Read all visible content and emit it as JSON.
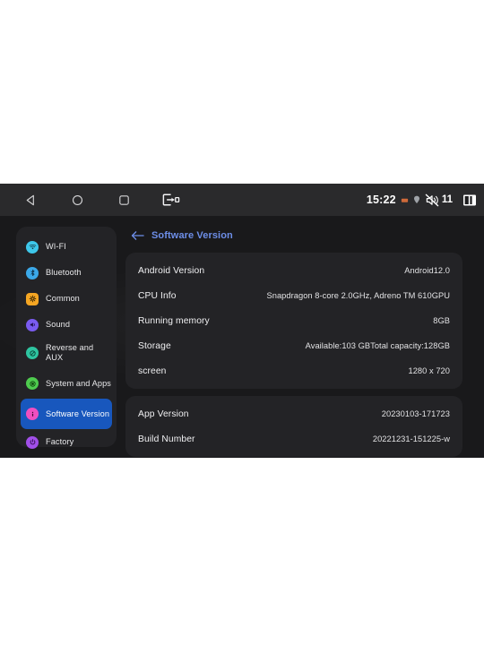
{
  "navbar": {
    "buttons": [
      {
        "name": "back",
        "icon": "triangle-left-icon",
        "label": "Back"
      },
      {
        "name": "home",
        "icon": "circle-icon",
        "label": "Home"
      },
      {
        "name": "recents",
        "icon": "square-icon",
        "label": "Recent apps"
      },
      {
        "name": "screenshot",
        "icon": "screenshot-icon",
        "label": "Screenshot"
      }
    ]
  },
  "statusbar": {
    "clock": "15:22",
    "volume_level": "11",
    "icons": [
      "sd-card-icon",
      "location-dot-icon",
      "volume-mute-icon",
      "split-screen-icon"
    ],
    "colors": {
      "sd_card": "#cf6a3a",
      "text": "#ffffff"
    }
  },
  "sidebar": {
    "items": [
      {
        "label": "WI-FI",
        "icon": "wifi-icon",
        "color": "#3ec7ea",
        "shape": "circle",
        "active": false
      },
      {
        "label": "Bluetooth",
        "icon": "bluetooth-icon",
        "color": "#3ba8e8",
        "shape": "circle",
        "active": false
      },
      {
        "label": "Common",
        "icon": "gear-icon",
        "color": "#f5a623",
        "shape": "square",
        "active": false
      },
      {
        "label": "Sound",
        "icon": "speaker-icon",
        "color": "#7a5bf0",
        "shape": "circle",
        "active": false
      },
      {
        "label": "Reverse and AUX",
        "icon": "reverse-icon",
        "color": "#2ec4a0",
        "shape": "circle",
        "active": false
      },
      {
        "label": "System and Apps",
        "icon": "system-icon",
        "color": "#4ecb4e",
        "shape": "circle",
        "active": false
      },
      {
        "label": "Software Version",
        "icon": "info-icon",
        "color": "#ef4fc0",
        "shape": "circle",
        "active": true
      },
      {
        "label": "Factory",
        "icon": "power-icon",
        "color": "#a14fe8",
        "shape": "circle",
        "active": false
      }
    ],
    "active_index": 6,
    "highlight_color": "#1857bd"
  },
  "content": {
    "title": "Software Version",
    "title_color": "#6d8ee8",
    "back_icon": "arrow-left-icon",
    "cards": [
      {
        "rows": [
          {
            "label": "Android Version",
            "value": "Android12.0"
          },
          {
            "label": "CPU Info",
            "value": "Snapdragon 8-core 2.0GHz, Adreno TM 610GPU"
          },
          {
            "label": "Running memory",
            "value": "8GB"
          },
          {
            "label": "Storage",
            "value": "Available:103 GBTotal capacity:128GB"
          },
          {
            "label": "screen",
            "value": "1280 x 720"
          }
        ]
      },
      {
        "rows": [
          {
            "label": "App Version",
            "value": "20230103-171723"
          },
          {
            "label": "Build Number",
            "value": "20221231-151225-w"
          }
        ]
      }
    ]
  }
}
